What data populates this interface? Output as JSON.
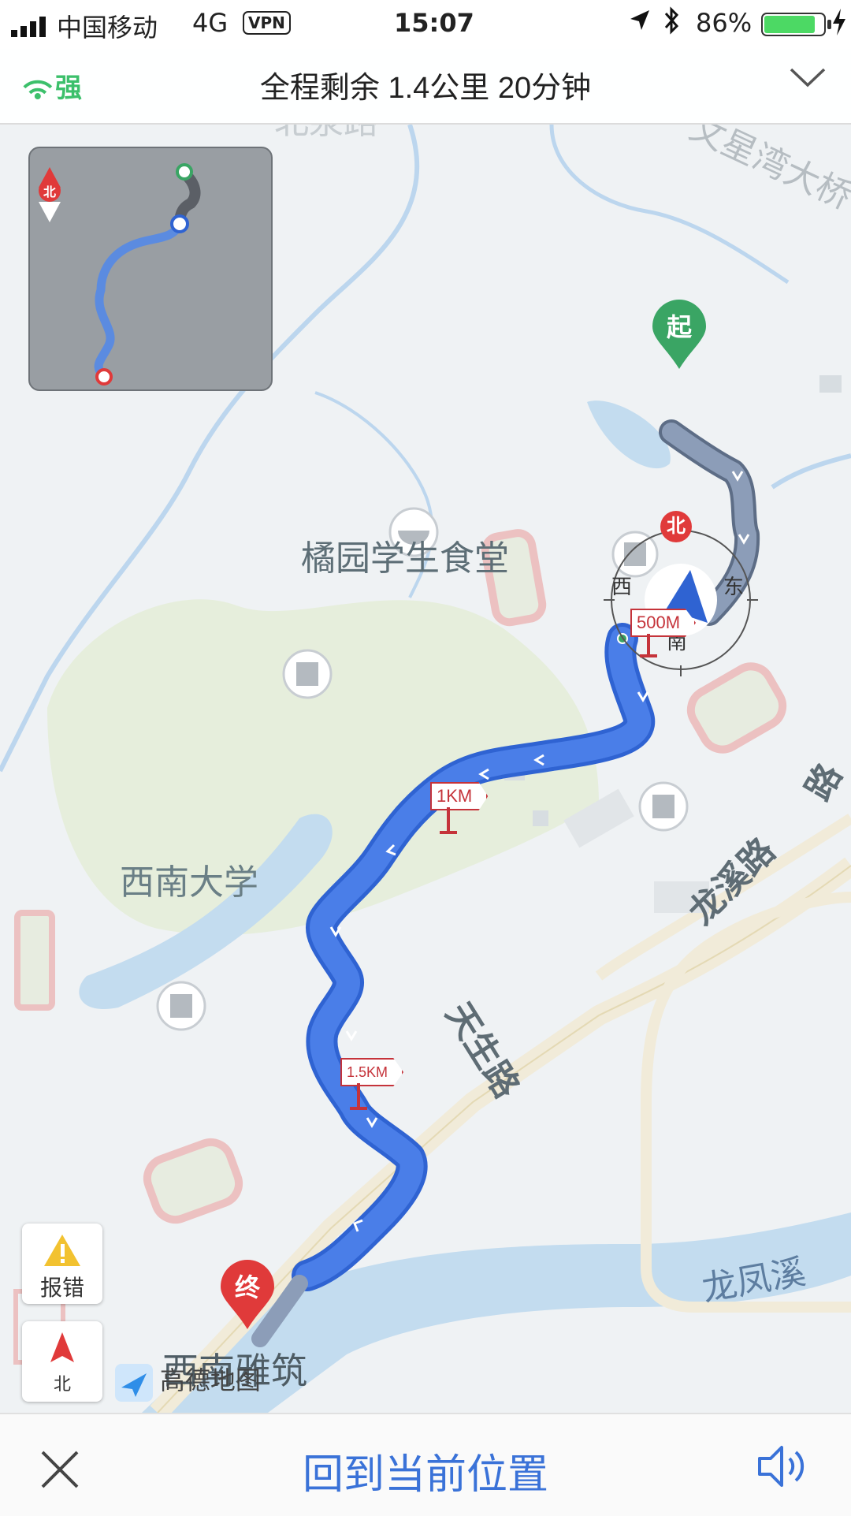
{
  "status_bar": {
    "carrier": "中国移动",
    "network": "4G",
    "vpn": "VPN",
    "time": "15:07",
    "battery": "86%",
    "battery_level": 0.86
  },
  "nav_header": {
    "gps_strength": "强",
    "route_summary": "全程剩余 1.4公里  20分钟"
  },
  "map": {
    "labels": {
      "canteen": "橘园学生食堂",
      "university": "西南大学",
      "yazhu": "西南雅筑",
      "longxi_road": "龙溪路",
      "tiansheng_road": "天生路",
      "longfeng_creek": "龙凤溪",
      "wenxing_bridge": "文星湾大桥",
      "beijing_road": "北泉路",
      "xinan_top": "西南大学",
      "road_right": "路"
    },
    "start_marker": "起",
    "end_marker": "终",
    "compass": {
      "north": "北",
      "south": "南",
      "east": "东",
      "west": "西"
    },
    "distance_markers": [
      "500M",
      "1KM",
      "1.5KM"
    ],
    "minimap_north": "北"
  },
  "controls": {
    "report_label": "报错",
    "north_label": "北",
    "logo_text": "高德地图"
  },
  "bottom_bar": {
    "return_label": "回到当前位置"
  },
  "colors": {
    "route_blue": "#4a7ee8",
    "route_traveled": "#8c9db8",
    "start_green": "#3aa564",
    "end_red": "#e03a3a",
    "accent_blue": "#3a72d8"
  }
}
